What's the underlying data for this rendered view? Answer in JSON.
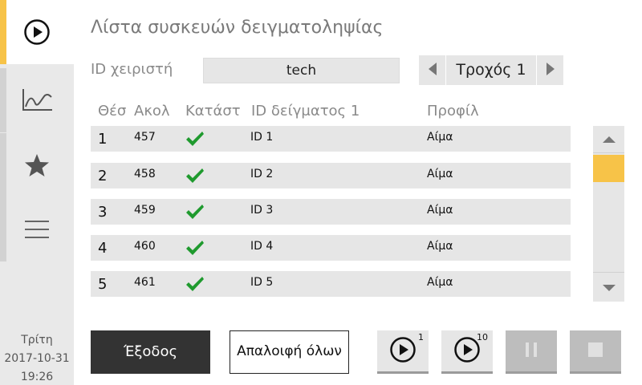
{
  "sidebar": {
    "items": [
      {
        "name": "play-circle-icon",
        "active": true
      },
      {
        "name": "chart-line-icon",
        "active": false
      },
      {
        "name": "star-icon",
        "active": false
      },
      {
        "name": "menu-icon",
        "active": false
      }
    ],
    "datetime": {
      "day": "Τρίτη",
      "date": "2017-10-31",
      "time": "19:26"
    }
  },
  "header": {
    "title": "Λίστα συσκευών δειγματοληψίας",
    "operator_label": "ID χειριστή",
    "operator_value": "tech",
    "rack_label": "Τροχός 1"
  },
  "table": {
    "columns": [
      "Θέσ",
      "Ακολ",
      "Κατάστ",
      "ID δείγματος 1",
      "Προφίλ"
    ],
    "rows": [
      {
        "pos": "1",
        "abs": "457",
        "status": "ok",
        "sample_id": "ID 1",
        "profile": "Αίμα"
      },
      {
        "pos": "2",
        "abs": "458",
        "status": "ok",
        "sample_id": "ID 2",
        "profile": "Αίμα"
      },
      {
        "pos": "3",
        "abs": "459",
        "status": "ok",
        "sample_id": "ID 3",
        "profile": "Αίμα"
      },
      {
        "pos": "4",
        "abs": "460",
        "status": "ok",
        "sample_id": "ID 4",
        "profile": "Αίμα"
      },
      {
        "pos": "5",
        "abs": "461",
        "status": "ok",
        "sample_id": "ID 5",
        "profile": "Αίμα"
      }
    ]
  },
  "footer": {
    "exit_label": "Έξοδος",
    "clear_label": "Απαλοιφή όλων",
    "run1_badge": "1",
    "run10_badge": "10"
  },
  "colors": {
    "accent": "#f7c348",
    "check": "#1f9a2e",
    "dark_button": "#333333"
  }
}
